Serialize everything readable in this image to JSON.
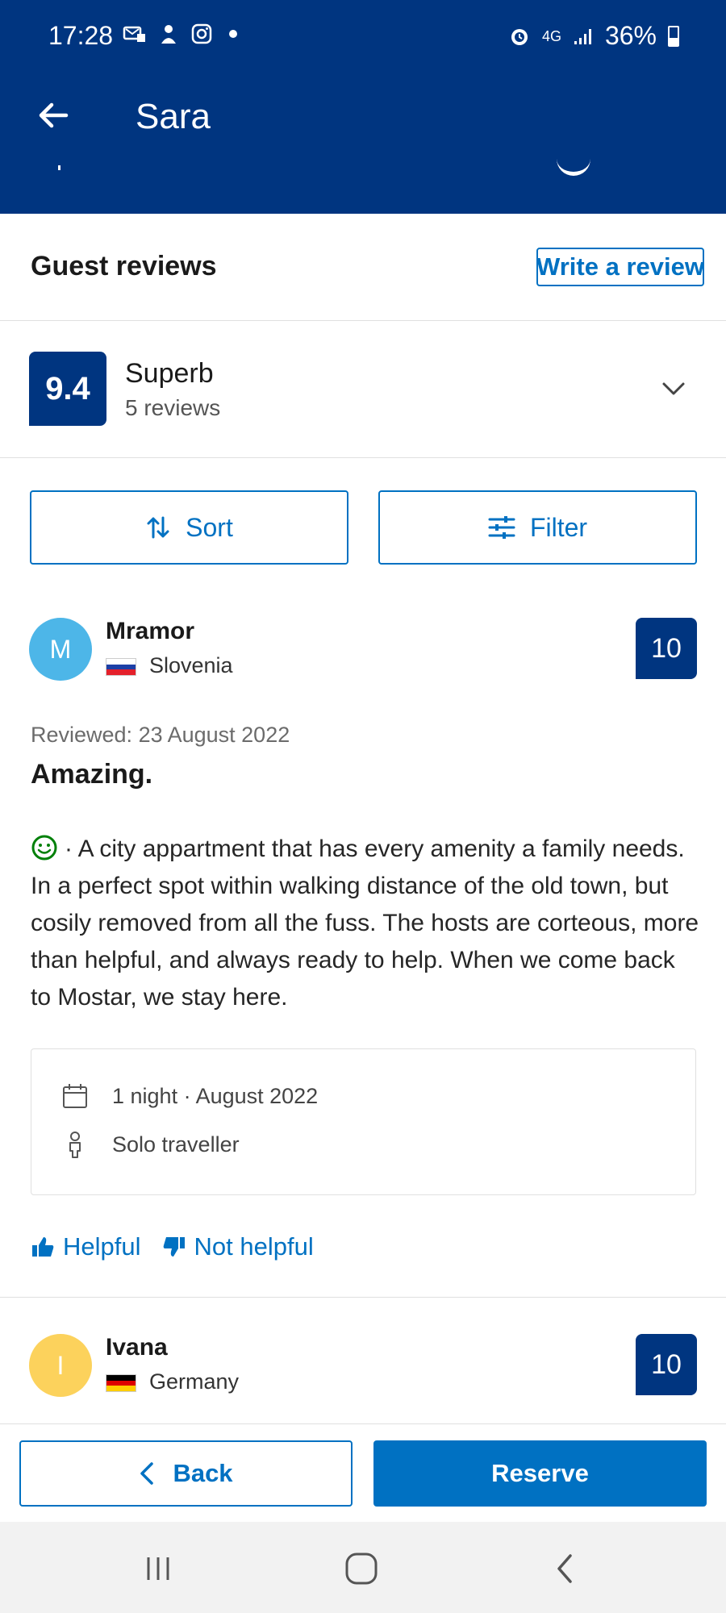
{
  "status_bar": {
    "time": "17:28",
    "battery": "36%",
    "network": "4G"
  },
  "header": {
    "title": "Sara",
    "back_icon": "arrow-left-icon"
  },
  "reviews_section": {
    "title": "Guest reviews",
    "write_review_label": "Write a review"
  },
  "summary": {
    "score": "9.4",
    "rating_word": "Superb",
    "review_count": "5 reviews"
  },
  "controls": {
    "sort_label": "Sort",
    "filter_label": "Filter"
  },
  "reviews": [
    {
      "avatar_initial": "M",
      "avatar_color": "#4db6e8",
      "name": "Mramor",
      "country": "Slovenia",
      "score": "10",
      "reviewed_date": "Reviewed: 23 August 2022",
      "title": "Amazing.",
      "body": "· A city appartment that has every amenity a family needs. In a perfect spot within walking distance of the old town, but cosily removed from all the fuss. The hosts are corteous, more than helpful, and always ready to help. When we come back to Mostar, we stay here.",
      "stay": "1 night · August 2022",
      "traveller_type": "Solo traveller",
      "helpful_label": "Helpful",
      "not_helpful_label": "Not helpful"
    },
    {
      "avatar_initial": "I",
      "avatar_color": "#fcd25c",
      "name": "Ivana",
      "country": "Germany",
      "score": "10"
    }
  ],
  "footer": {
    "back_label": "Back",
    "reserve_label": "Reserve"
  },
  "colors": {
    "brand_dark": "#003580",
    "brand_blue": "#0071c2",
    "positive_green": "#008009"
  }
}
